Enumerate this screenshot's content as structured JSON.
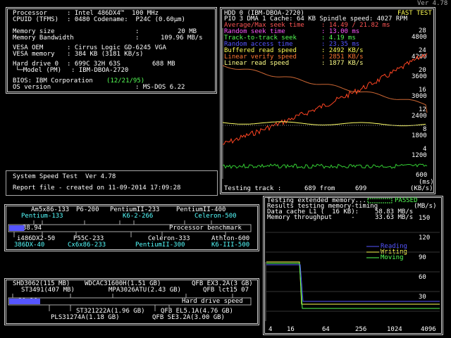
{
  "version_top": "Ver 4.78",
  "sysinfo": {
    "processor_label": "Processor",
    "processor_value": ": Intel 486DX4™  100 MHz",
    "cpuid_label": "CPUID (TFMS)",
    "cpuid_value": ": 0480 Codename:  P24C (0.60µm)",
    "memsize_label": "Memory size",
    "memsize_value": "20 MB",
    "membw_label": "Memory Bandwidth",
    "membw_value": "109.96 MB/s",
    "vesaoem_label": "VESA OEM",
    "vesaoem_value": ": Cirrus Logic GD-6245 VGA",
    "vesamem_label": "VESA memory",
    "vesamem_value": ": 384 KB (3181 KB/s)",
    "hdd_label": "Hard drive 0",
    "hdd_value": ": 699C 32H 63S",
    "hdd_size": "688 MB",
    "model_label": "└─Model (PM)",
    "model_value": ": IBM-DBOA-2720",
    "bios_label": "BIOS: IBM Corporation",
    "bios_date": "(12/21/95)",
    "os_label": "OS version",
    "os_value": ": MS-DOS 6.22"
  },
  "status": {
    "title": "System Speed Test  Ver 4.78",
    "report": "Report file - created on 11-09-2014 17:09:28"
  },
  "hdd_panel": {
    "header": "HDD 0 (IBM-DBOA-2720)",
    "mode": "FAST TEST",
    "pio": "PIO 3 DMA 1 Cache: 64 KB Spindle speed: 4027 RPM",
    "metrics": [
      {
        "label": "Average/Max seek time",
        "value": ": 14.49 / 21.82 ms",
        "color": "#ff5555"
      },
      {
        "label": "Random seek time",
        "value": ": 13.00 ms",
        "color": "#ff55ff"
      },
      {
        "label": "Track-to-track seek",
        "value": ": 4.19 ms",
        "color": "#55ff55"
      },
      {
        "label": "Random access time",
        "value": ": 23.35 ms",
        "color": "#5555ff"
      },
      {
        "label": "Buffered read speed",
        "value": ": 2492 KB/s",
        "color": "#ffff55"
      },
      {
        "label": "Linear verify speed",
        "value": ": 2851 KB/s",
        "color": "#ff7733"
      },
      {
        "label": "Linear read speed",
        "value": ": 1877 KB/s",
        "color": "#ffff88"
      }
    ],
    "ms_axis": [
      "28",
      "24",
      "20",
      "16",
      "12",
      "8",
      "4"
    ],
    "kbs_axis": [
      "4800",
      "4200",
      "3600",
      "3000",
      "2400",
      "1800",
      "1200",
      "600"
    ],
    "testing_label": "Testing track :",
    "testing_from": "689 from",
    "testing_to": "699",
    "units_ms": "(ms)",
    "units_kbs": "(KB/s)"
  },
  "cpu_bench": {
    "title": "Processor benchmark",
    "value": "38.94",
    "fill_fraction": 0.18,
    "top_row1": [
      "Am5x86-133",
      "P6-200",
      "PentiumII-233",
      "PentiumII-400"
    ],
    "top_row2": [
      "Pentium-133",
      "K6-2-266",
      "Celeron-500"
    ],
    "bot_row1": [
      "i486DX2-50",
      "P55C-233",
      "Celeron-333",
      "Athlon-600"
    ],
    "bot_row2": [
      "386DX-40",
      "Cx6x86-233",
      "PentiumII-300",
      "K6-III-500"
    ]
  },
  "hdd_bench": {
    "title": "Hard drive speed",
    "value": "39.36",
    "fill_fraction": 0.16,
    "top_row1": [
      "SHD3062(115 MB)",
      "WDCAC31600H(1.51 GB)",
      "QFB EX3.2A(3 GB)"
    ],
    "top_row2": [
      "ST3491(407 MB)",
      "MPA3026ATU(2.43 GB)",
      "QFB lct15 07"
    ],
    "bot_row1": [
      "ST321222A(1.96 GB)",
      "QFB EL5.1A(4.76 GB)"
    ],
    "bot_row2": [
      "PLS31274A(1.18 GB)",
      "QFB SE3.2A(3.00 GB)"
    ]
  },
  "mem_panel": {
    "testing": "Testing extended memory...",
    "passed": "PASSED",
    "results": "Results testing memory-timing",
    "units": "(MB/s)",
    "cache_label": "Data cache L1 (  16 KB):",
    "cache_value": "58.83 MB/s",
    "throughput_label": "Memory throughput     -",
    "throughput_value": "33.63 MB/s",
    "y_axis": [
      "150",
      "120",
      "90",
      "60",
      "30"
    ],
    "x_axis": [
      "4",
      "16",
      "64",
      "256",
      "1024",
      "4096"
    ],
    "legend": [
      {
        "name": "Reading",
        "color": "#5555ff"
      },
      {
        "name": "Writing",
        "color": "#ffff55"
      },
      {
        "name": "Moving",
        "color": "#55ff55"
      }
    ]
  }
}
